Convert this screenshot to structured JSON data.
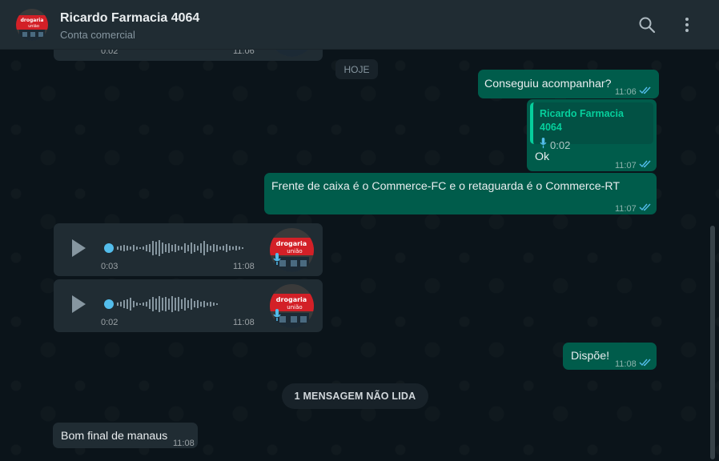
{
  "header": {
    "contact_name": "Ricardo Farmacia 4064",
    "subtitle": "Conta comercial",
    "avatar_text_top": "drogaria",
    "avatar_text_bottom": "união"
  },
  "colors": {
    "outgoing_bubble": "#005c4b",
    "incoming_bubble": "#202c33",
    "read_tick": "#53bdeb",
    "accent": "#06cf9c"
  },
  "top_voice": {
    "duration": "0:02",
    "time": "11:06"
  },
  "date_divider": "HOJE",
  "messages": [
    {
      "text": "Conseguiu acompanhar?",
      "time": "11:06"
    },
    {
      "quote_name": "Ricardo Farmacia 4064",
      "quote_duration": "0:02",
      "text": "Ok",
      "time": "11:07"
    },
    {
      "text": "Frente de caixa é o Commerce-FC e o retaguarda é o Commerce-RT",
      "time": "11:07"
    },
    {
      "text": "Dispõe!",
      "time": "11:08"
    }
  ],
  "voice_messages": [
    {
      "duration": "0:03",
      "time": "11:08"
    },
    {
      "duration": "0:02",
      "time": "11:08"
    }
  ],
  "unread_divider": "1 MENSAGEM NÃO LIDA",
  "incoming_last": {
    "text": "Bom final de manaus",
    "time": "11:08"
  }
}
